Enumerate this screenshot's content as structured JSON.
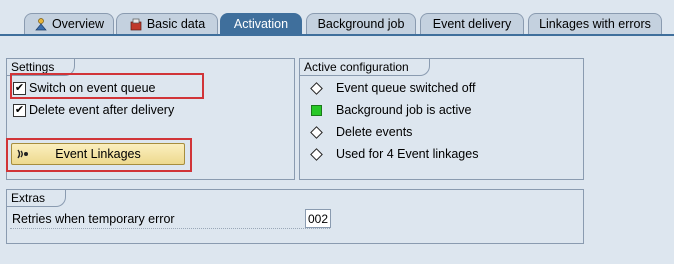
{
  "tabs": [
    {
      "label": "Overview",
      "icon": "overview-icon",
      "active": false
    },
    {
      "label": "Basic data",
      "icon": "basic-data-icon",
      "active": false
    },
    {
      "label": "Activation",
      "active": true
    },
    {
      "label": "Background job",
      "active": false
    },
    {
      "label": "Event delivery",
      "active": false
    },
    {
      "label": "Linkages with errors",
      "active": false
    }
  ],
  "settings": {
    "title": "Settings",
    "switch_on_label": "Switch on event queue",
    "switch_on_checked": true,
    "delete_event_label": "Delete event after delivery",
    "delete_event_checked": true,
    "check_glyph": "✔",
    "button_label": "Event Linkages",
    "button_icon": "event-linkages-icon"
  },
  "active_configuration": {
    "title": "Active configuration",
    "items": [
      {
        "label": "Event queue switched off",
        "indicator": "diamond-icon"
      },
      {
        "label": "Background job is active",
        "indicator": "green-square-icon",
        "color": "#27c827"
      },
      {
        "label": "Delete events",
        "indicator": "diamond-icon"
      },
      {
        "label": "Used for 4 Event linkages",
        "indicator": "diamond-icon"
      }
    ]
  },
  "extras": {
    "title": "Extras",
    "retries_label": "Retries when temporary error",
    "retries_value": "002"
  },
  "colors": {
    "background": "#dde6ef",
    "active_tab": "#3f6f9c",
    "highlight": "#d13438",
    "button": "#f3e2a3"
  }
}
